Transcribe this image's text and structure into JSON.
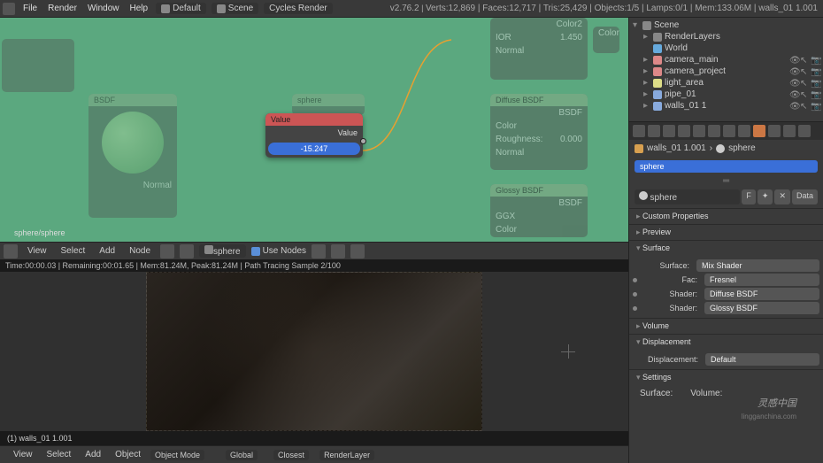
{
  "topbar": {
    "menus": [
      "File",
      "Render",
      "Window",
      "Help"
    ],
    "layout": "Default",
    "scene": "Scene",
    "engine": "Cycles Render",
    "version": "v2.76.2",
    "stats": "Verts:12,869 | Faces:12,717 | Tris:25,429 | Objects:1/5 | Lamps:0/1 | Mem:133.06M | walls_01 1.001"
  },
  "node_editor": {
    "path": "sphere/sphere",
    "menus": [
      "View",
      "Select",
      "Add",
      "Node"
    ],
    "material": "sphere",
    "use_nodes_label": "Use Nodes",
    "nodes": {
      "value": {
        "title": "Value",
        "row": "Value",
        "value": "-15.247"
      },
      "ior": {
        "label": "IOR",
        "value": "1.450"
      },
      "color2": "Color2",
      "normal": "Normal",
      "color_out": "Color",
      "bsdf": "BSDF",
      "diffuse": {
        "title": "Diffuse BSDF",
        "color": "Color",
        "rough": "Roughness:",
        "rval": "0.000",
        "normal": "Normal",
        "bsdf": "BSDF"
      },
      "glossy": {
        "title": "Glossy BSDF",
        "ggx": "GGX",
        "color": "Color",
        "bsdf": "BSDF"
      },
      "sph": "sphere"
    }
  },
  "render": {
    "stats": "Time:00:00.03 | Remaining:00:01.65 | Mem:81.24M, Peak:81.24M | Path Tracing Sample 2/100",
    "slot": "(1) walls_01 1.001",
    "bar": {
      "menus": [
        "View",
        "Select",
        "Add",
        "Object"
      ],
      "mode": "Object Mode",
      "orient": "Global",
      "closest": "Closest",
      "layer": "RenderLayer"
    }
  },
  "outliner": {
    "items": [
      {
        "name": "Scene",
        "type": "scene"
      },
      {
        "name": "RenderLayers",
        "type": "layers"
      },
      {
        "name": "World",
        "type": "world"
      },
      {
        "name": "camera_main",
        "type": "cam"
      },
      {
        "name": "camera_project",
        "type": "cam"
      },
      {
        "name": "light_area",
        "type": "light"
      },
      {
        "name": "pipe_01",
        "type": "mesh"
      },
      {
        "name": "walls_01 1",
        "type": "mesh"
      }
    ]
  },
  "props": {
    "crumb_obj": "walls_01 1.001",
    "crumb_mat": "sphere",
    "mat_name": "sphere",
    "mat_field": "sphere",
    "f_btn": "F",
    "data_btn": "Data",
    "panels": {
      "custom": "Custom Properties",
      "preview": "Preview",
      "surface": "Surface",
      "volume": "Volume",
      "displacement": "Displacement",
      "settings": "Settings"
    },
    "surface": {
      "surface_lbl": "Surface:",
      "surface_val": "Mix Shader",
      "fac_lbl": "Fac:",
      "fac_val": "Fresnel",
      "shader1_lbl": "Shader:",
      "shader1_val": "Diffuse BSDF",
      "shader2_lbl": "Shader:",
      "shader2_val": "Glossy BSDF"
    },
    "disp": {
      "lbl": "Displacement:",
      "val": "Default"
    },
    "settings": {
      "surf": "Surface:",
      "vol": "Volume:"
    }
  },
  "watermark": {
    "cn": "灵感中国",
    "url": "lingganchina.com"
  }
}
